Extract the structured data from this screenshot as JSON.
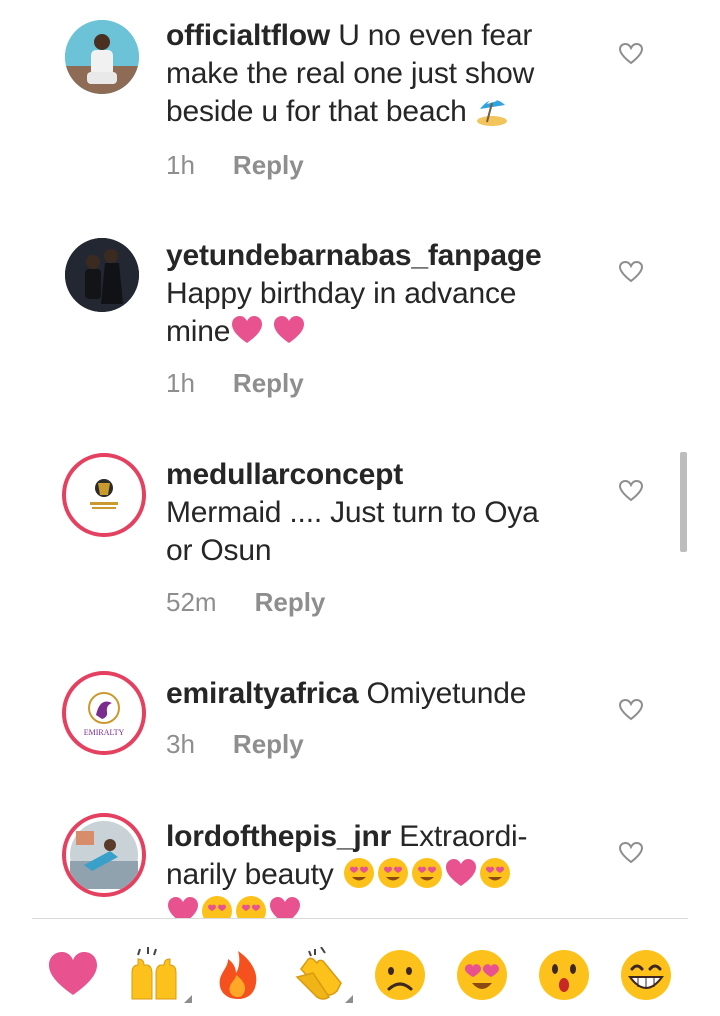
{
  "comments": [
    {
      "username": "officialtflow",
      "text": "U no even fear make the real one just show beside u for that beach",
      "line1": "U no even fear",
      "line2": "make the real one just show",
      "line3": "beside u for that beach",
      "time": "1h",
      "reply": "Reply",
      "trailing_emoji": "beach-umbrella"
    },
    {
      "username": "yetundebarnabas_fanpage",
      "line1": "Happy birthday in advance",
      "line2": "mine",
      "trailing_emoji": "pink-heart pink-heart",
      "time": "1h",
      "reply": "Reply"
    },
    {
      "username": "medullarconcept",
      "line1": "Mermaid .... Just turn to Oya",
      "line2": "or Osun",
      "time": "52m",
      "reply": "Reply"
    },
    {
      "username": "emiraltyafrica",
      "line1": "Omiyetunde",
      "time": "3h",
      "reply": "Reply",
      "avatar_text": "EMIRALTY"
    },
    {
      "username": "lordofthepis_jnr",
      "line1": "Extraordi-",
      "line2": "narily beauty",
      "trailing_emoji": "heart-eyes heart-eyes heart-eyes pink-heart heart-eyes"
    }
  ],
  "emoji_bar": [
    "heart",
    "raised-hands",
    "fire",
    "clapping-hands",
    "frowning-face",
    "heart-eyes",
    "astonished-face",
    "grinning-face"
  ],
  "colors": {
    "accent_ring": "#e4405f",
    "heart_pink": "#e8538f",
    "emoji_yellow": "#fcc21b",
    "muted": "#8e8e8e"
  }
}
